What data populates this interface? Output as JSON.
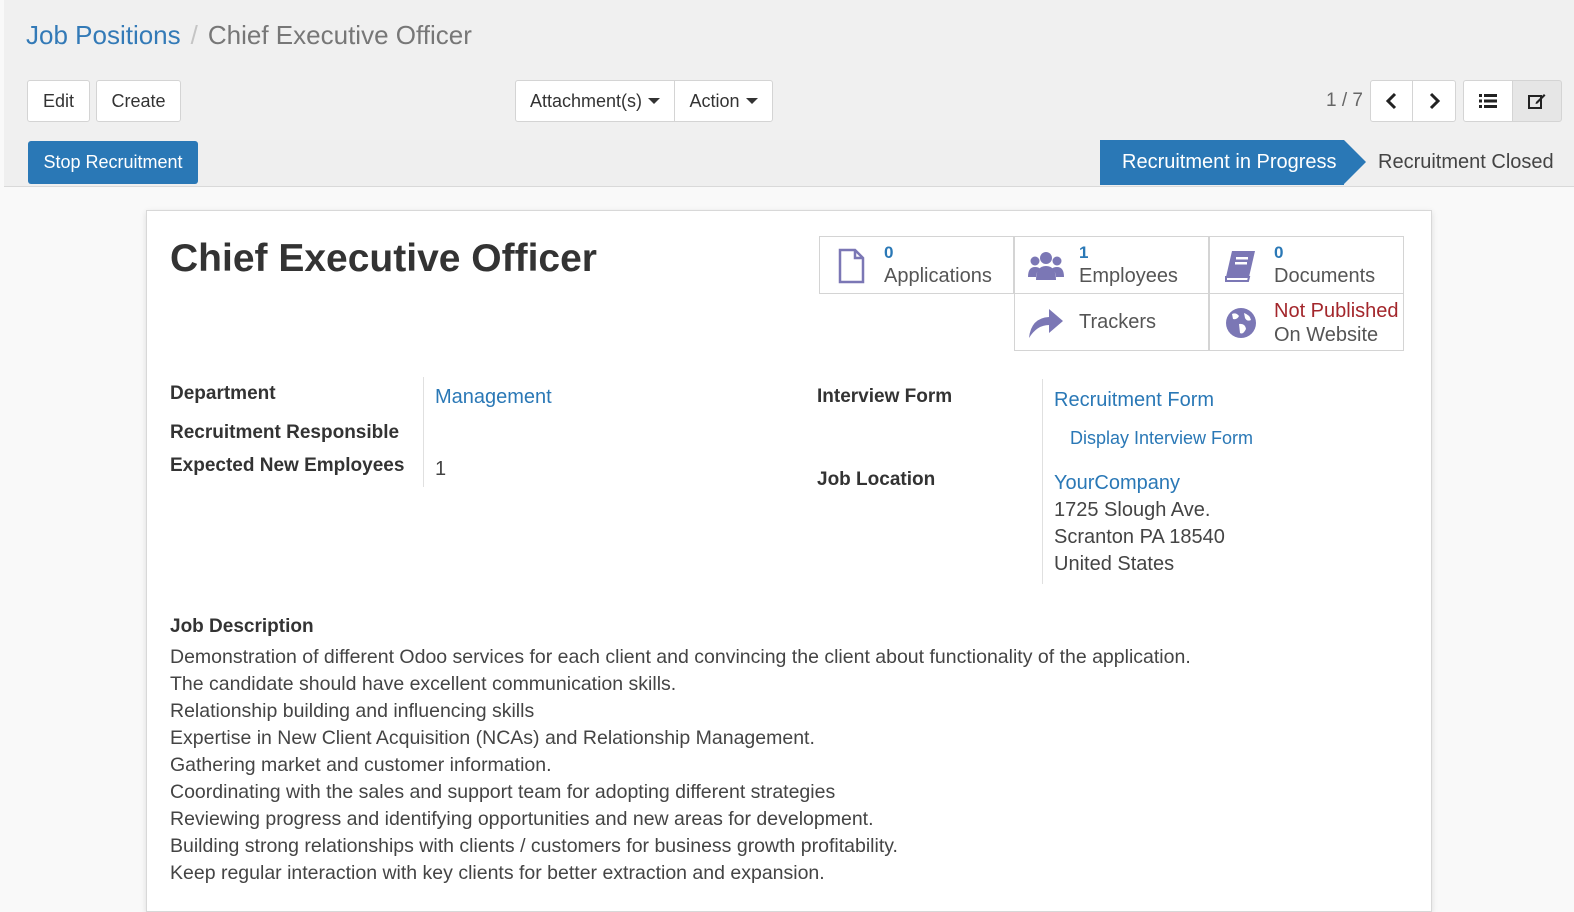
{
  "breadcrumb": {
    "parent": "Job Positions",
    "separator": "/",
    "current": "Chief Executive Officer"
  },
  "toolbar": {
    "edit_label": "Edit",
    "create_label": "Create",
    "attachments_label": "Attachment(s)",
    "action_label": "Action",
    "pager": "1 / 7"
  },
  "statusbar": {
    "stop_label": "Stop Recruitment",
    "stage_active": "Recruitment in Progress",
    "stage_inactive": "Recruitment Closed"
  },
  "form": {
    "title": "Chief Executive Officer",
    "smart_buttons": {
      "applications": {
        "count": "0",
        "label": "Applications"
      },
      "employees": {
        "count": "1",
        "label": "Employees"
      },
      "documents": {
        "count": "0",
        "label": "Documents"
      },
      "trackers": {
        "label": "Trackers"
      },
      "website": {
        "status": "Not Published",
        "label": "On Website"
      }
    },
    "fields": {
      "department_label": "Department",
      "department_value": "Management",
      "responsible_label": "Recruitment Responsible",
      "expected_label": "Expected New Employees",
      "expected_value": "1",
      "interview_label": "Interview Form",
      "interview_value": "Recruitment Form",
      "interview_display": "Display Interview Form",
      "location_label": "Job Location",
      "location_company": "YourCompany",
      "location_street": "1725 Slough Ave.",
      "location_city": "Scranton PA 18540",
      "location_country": "United States"
    },
    "description_label": "Job Description",
    "description_lines": [
      "Demonstration of different Odoo services for each client and convincing the client about functionality of the application.",
      "The candidate should have excellent communication skills.",
      "Relationship building and influencing skills",
      "Expertise in New Client Acquisition (NCAs) and Relationship Management.",
      "Gathering market and customer information.",
      "Coordinating with the sales and support team for adopting different strategies",
      "Reviewing progress and identifying opportunities and new areas for development.",
      "Building strong relationships with clients / customers for business growth profitability.",
      "Keep regular interaction with key clients for better extraction and expansion."
    ]
  },
  "colors": {
    "primary": "#2a78b6",
    "danger": "#a3262b",
    "icon": "#7b77b5"
  },
  "icons": [
    "file-icon",
    "users-icon",
    "book-icon",
    "share-icon",
    "globe-icon",
    "chevron-left-icon",
    "chevron-right-icon",
    "list-view-icon",
    "form-view-icon",
    "caret-down-icon"
  ]
}
